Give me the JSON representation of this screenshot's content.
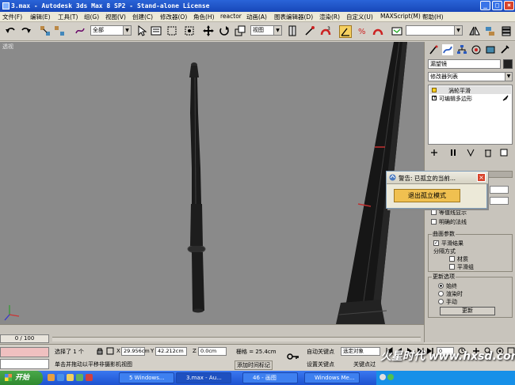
{
  "window": {
    "title": "3.max - Autodesk 3ds Max 8 SP2 - Stand-alone License",
    "controls": [
      "_",
      "□",
      "×"
    ]
  },
  "menu": [
    "文件(F)",
    "编辑(E)",
    "工具(T)",
    "组(G)",
    "视图(V)",
    "创建(C)",
    "修改器(O)",
    "角色(H)",
    "reactor",
    "动画(A)",
    "图表编辑器(D)",
    "渲染(R)",
    "自定义(U)",
    "MAXScript(M)",
    "帮助(H)"
  ],
  "toolbar": {
    "selection_filter": "全部",
    "coord_system": "视图"
  },
  "viewport": {
    "label": "透视"
  },
  "command_panel": {
    "object_name": "漏望镜",
    "modifier_list": "修改器列表",
    "stack": [
      "涡轮平滑",
      "可编辑多边形"
    ],
    "main_section": {
      "isoline_display": "等值线显示",
      "explicit_normals": "明确的法线"
    },
    "surface_params": {
      "title": "曲面参数",
      "smooth_result": "平滑结果",
      "separate_by": "分隔方式",
      "materials": "材质",
      "smoothing_groups": "平滑组"
    },
    "update_options": {
      "title": "更新选项",
      "always": "始终",
      "when_rendering": "渲染时",
      "manually": "手动",
      "update_button": "更新"
    }
  },
  "dialog": {
    "title": "警告: 已孤立的当前...",
    "button": "退出孤立模式"
  },
  "timeline": {
    "frame": "0 / 100"
  },
  "status": {
    "selected": "选择了 1 个",
    "x_label": "X",
    "x_value": "29.956cm",
    "y_label": "Y",
    "y_value": "42.212cm",
    "z_label": "Z",
    "z_value": "0.0cm",
    "grid": "栅格 = 25.4cm",
    "prompt": "单击并拖动以平移非摄影机视图",
    "add_time_tag": "添加时间标记",
    "auto_key": "自动关键点",
    "selected_object": "选定对象",
    "set_key": "设置关键点",
    "key_filters": "关键点过",
    "frame_field": "0"
  },
  "taskbar": {
    "start": "开始",
    "tasks": [
      "5 Windows...",
      "3.max - Au...",
      "46 - 画图",
      "Windows Me..."
    ]
  },
  "watermark": "火星时代 www.hxsd.com"
}
